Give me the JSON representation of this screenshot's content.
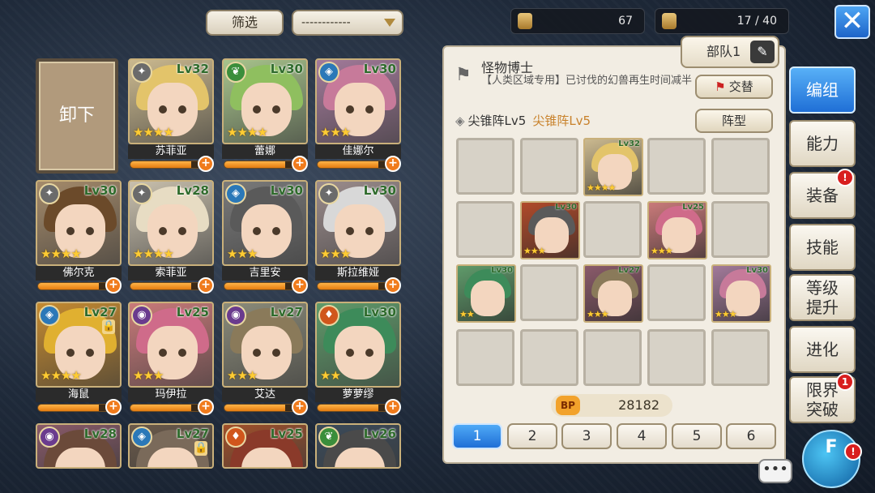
{
  "top": {
    "filter_label": "筛选",
    "sort_dropdown_value": "------------",
    "resource1_value": "67",
    "resource2_value": "17 / 40"
  },
  "unload_label": "卸下",
  "characters": [
    {
      "name": "苏菲亚",
      "level": "Lv32",
      "stars": "★★★★",
      "element": "wind",
      "exp": 0.85
    },
    {
      "name": "蕾娜",
      "level": "Lv30",
      "stars": "★★★★",
      "element": "leaf",
      "exp": 0.85
    },
    {
      "name": "佳娜尔",
      "level": "Lv30",
      "stars": "★★★",
      "element": "water",
      "exp": 0.85
    },
    {
      "name": "佛尔克",
      "level": "Lv30",
      "stars": "★★★★",
      "element": "wind",
      "exp": 0.85
    },
    {
      "name": "索菲亚",
      "level": "Lv28",
      "stars": "★★★★",
      "element": "wind",
      "exp": 0.85
    },
    {
      "name": "吉里安",
      "level": "Lv30",
      "stars": "★★★",
      "element": "water",
      "exp": 0.85
    },
    {
      "name": "斯拉维娅",
      "level": "Lv30",
      "stars": "★★★",
      "element": "wind",
      "exp": 0.85
    },
    {
      "name": "海鼠",
      "level": "Lv27",
      "stars": "★★★★",
      "element": "water",
      "exp": 0.85,
      "locked": true
    },
    {
      "name": "玛伊拉",
      "level": "Lv25",
      "stars": "★★★",
      "element": "dark",
      "exp": 0.85
    },
    {
      "name": "艾达",
      "level": "Lv27",
      "stars": "★★★",
      "element": "dark",
      "exp": 0.85
    },
    {
      "name": "萝萝缪",
      "level": "Lv30",
      "stars": "★★",
      "element": "fire",
      "exp": 0.85
    },
    {
      "name": "",
      "level": "Lv28",
      "stars": "",
      "element": "dark",
      "exp": 0
    },
    {
      "name": "",
      "level": "Lv27",
      "stars": "",
      "element": "water",
      "exp": 0,
      "locked": true
    },
    {
      "name": "",
      "level": "Lv25",
      "stars": "",
      "element": "fire",
      "exp": 0
    },
    {
      "name": "",
      "level": "Lv26",
      "stars": "",
      "element": "leaf",
      "exp": 0
    }
  ],
  "panel": {
    "team_tab": "部队1",
    "leader_title": "怪物博士",
    "leader_desc": "【人类区域专用】已讨伐的幻兽再生时间减半",
    "swap_label": "交替",
    "formation_name": "尖锥阵Lv5",
    "formation_name_alt": "尖锥阵Lv5",
    "formation_button": "阵型",
    "units": [
      {
        "level": "Lv32",
        "stars": "★★★★"
      },
      {
        "level": "Lv30",
        "stars": "★★★"
      },
      {
        "level": "Lv25",
        "stars": "★★★"
      },
      {
        "level": "Lv30",
        "stars": "★★"
      },
      {
        "level": "Lv27",
        "stars": "★★★"
      },
      {
        "level": "Lv30",
        "stars": "★★★"
      }
    ],
    "bp_label": "BP",
    "bp_value": "28182",
    "pages": [
      "1",
      "2",
      "3",
      "4",
      "5",
      "6"
    ]
  },
  "side_tabs": [
    {
      "label": "编组",
      "active": true
    },
    {
      "label": "能力"
    },
    {
      "label": "装备",
      "alert": "!"
    },
    {
      "label": "技能"
    },
    {
      "label": "等级\n提升"
    },
    {
      "label": "进化"
    },
    {
      "label": "限界\n突破",
      "alert": "1"
    }
  ],
  "colors": {
    "accent": "#1f6fd6",
    "orange_bar": "#e37b10",
    "wind": "#6b6b6b",
    "leaf": "#3b8e3b",
    "water": "#2b78b8",
    "dark": "#6a3b8e",
    "fire": "#d0561c"
  }
}
